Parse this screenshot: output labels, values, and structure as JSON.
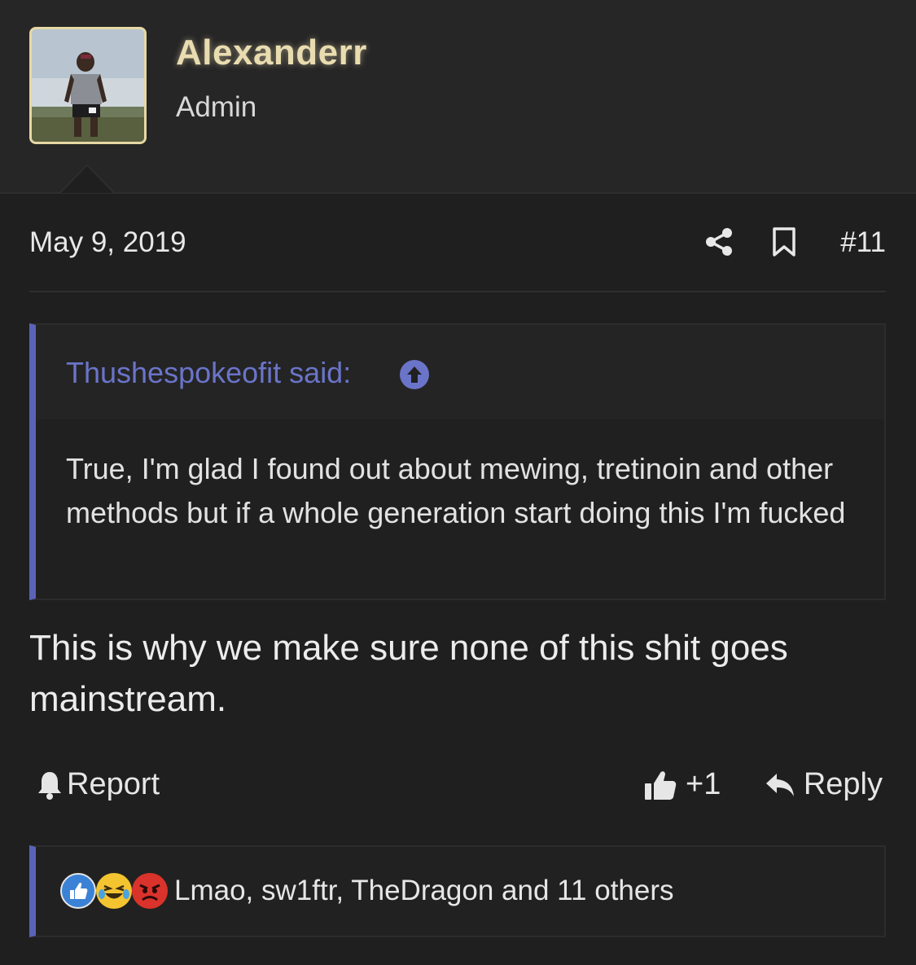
{
  "post": {
    "username": "Alexanderr",
    "role": "Admin",
    "date": "May 9, 2019",
    "post_number": "#11",
    "quote": {
      "author_label": "Thushespokeofit said:",
      "text": "True, I'm glad I found out about mewing, tretinoin and other methods but if a whole generation start doing this I'm fucked"
    },
    "body": "This is why we make sure none of this shit goes mainstream.",
    "actions": {
      "report_label": "Report",
      "like_label": "+1",
      "reply_label": "Reply"
    },
    "reactions": {
      "summary": "Lmao, sw1ftr, TheDragon and 11 others",
      "icons": [
        "like-reaction-icon",
        "laugh-cry-reaction-icon",
        "angry-reaction-icon"
      ]
    }
  },
  "colors": {
    "username": "#e9dcb0",
    "quote_accent": "#5b63b8",
    "quote_author": "#6a74c9",
    "background": "#1f1f1f"
  }
}
